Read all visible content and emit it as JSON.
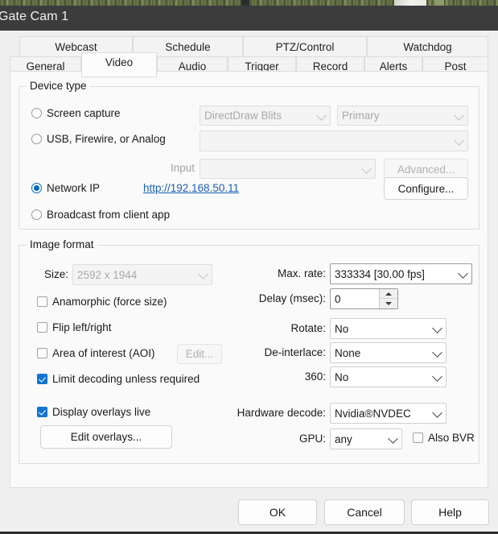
{
  "window": {
    "title": "Gate Cam 1"
  },
  "tabs": {
    "row1": [
      {
        "label": "Webcast",
        "active": false
      },
      {
        "label": "Schedule",
        "active": false
      },
      {
        "label": "PTZ/Control",
        "active": false
      },
      {
        "label": "Watchdog",
        "active": false
      }
    ],
    "row2": [
      {
        "label": "General",
        "active": false
      },
      {
        "label": "Video",
        "active": true
      },
      {
        "label": "Audio",
        "active": false
      },
      {
        "label": "Trigger",
        "active": false
      },
      {
        "label": "Record",
        "active": false
      },
      {
        "label": "Alerts",
        "active": false
      },
      {
        "label": "Post",
        "active": false
      }
    ]
  },
  "device_type": {
    "legend": "Device type",
    "screen_capture": {
      "label": "Screen capture",
      "selected": false,
      "method": "DirectDraw Blits",
      "monitor": "Primary"
    },
    "usb": {
      "label": "USB, Firewire, or Analog",
      "selected": false,
      "device": "",
      "input_label": "Input",
      "input_value": "",
      "advanced_label": "Advanced..."
    },
    "network_ip": {
      "label": "Network IP",
      "selected": true,
      "url": "http://192.168.50.11",
      "configure_label": "Configure..."
    },
    "broadcast": {
      "label": "Broadcast from client app",
      "selected": false
    }
  },
  "image_format": {
    "legend": "Image format",
    "size_label": "Size:",
    "size_value": "2592 x 1944",
    "anamorphic": {
      "label": "Anamorphic (force size)",
      "checked": false
    },
    "flip": {
      "label": "Flip left/right",
      "checked": false
    },
    "aoi": {
      "label": "Area of interest (AOI)",
      "checked": false,
      "edit_label": "Edit..."
    },
    "limit_decoding": {
      "label": "Limit decoding unless required",
      "checked": true
    },
    "display_overlays": {
      "label": "Display overlays live",
      "checked": true
    },
    "edit_overlays_label": "Edit overlays...",
    "max_rate_label": "Max. rate:",
    "max_rate_value": "333334 [30.00 fps]",
    "delay_label": "Delay (msec):",
    "delay_value": "0",
    "rotate_label": "Rotate:",
    "rotate_value": "No",
    "deinterlace_label": "De-interlace:",
    "deinterlace_value": "None",
    "threesixty_label": "360:",
    "threesixty_value": "No",
    "hardware_decode_label": "Hardware decode:",
    "hardware_decode_value": "Nvidia®NVDEC",
    "gpu_label": "GPU:",
    "gpu_value": "any",
    "also_bvr": {
      "label": "Also BVR",
      "checked": false
    }
  },
  "footer": {
    "ok_label": "OK",
    "cancel_label": "Cancel",
    "help_label": "Help"
  },
  "colors": {
    "accent": "#0067c0",
    "checkbox_fill": "#1174d4",
    "link": "#1a5fb4",
    "titlebar": "#3c3c3c"
  }
}
